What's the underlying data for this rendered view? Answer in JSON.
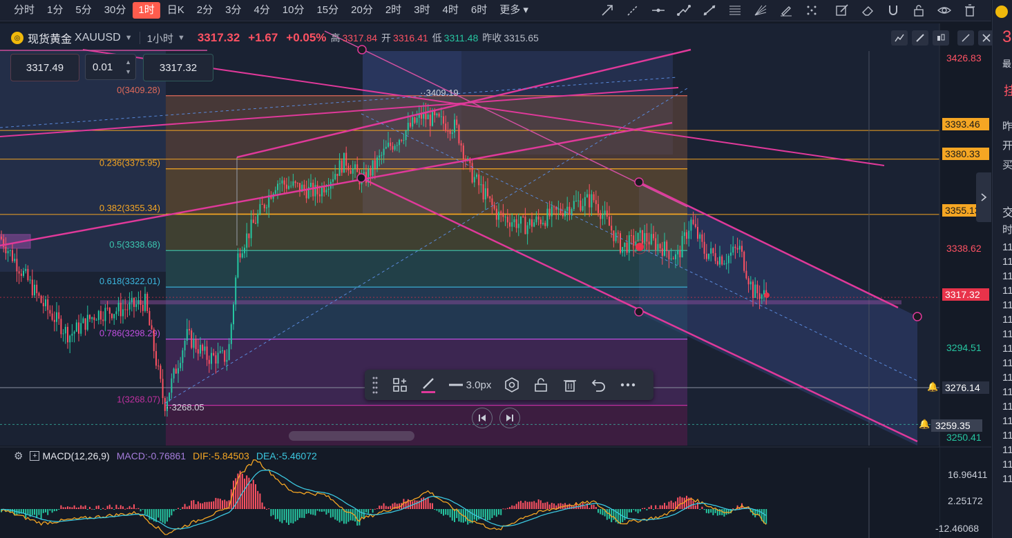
{
  "timeframes": [
    "分时",
    "1分",
    "5分",
    "30分",
    "1时",
    "日K",
    "2分",
    "3分",
    "4分",
    "10分",
    "15分",
    "20分",
    "2时",
    "3时",
    "4时",
    "6时",
    "更多"
  ],
  "active_timeframe": "1时",
  "symbol": {
    "name": "现货黄金",
    "code": "XAUUSD",
    "period": "1小时",
    "price": "3317.32",
    "change": "+1.67",
    "change_pct": "+0.05%",
    "high_label": "高",
    "high": "3317.84",
    "open_label": "开",
    "open": "3316.41",
    "low_label": "低",
    "low": "3311.48",
    "prev_label": "昨收",
    "prev": "3315.65"
  },
  "order": {
    "bid": "3317.49",
    "lot": "0.01",
    "ask": "3317.32"
  },
  "fib": {
    "l0": "0(3409.28)",
    "l236": "0.236(3375.95)",
    "l382": "0.382(3355.34)",
    "l5": "0.5(3338.68)",
    "l618": "0.618(3322.01)",
    "l786": "0.786(3298.29)",
    "l1": "1(3268.07)"
  },
  "annotations": {
    "peak": "3409.19",
    "trough": "3268.05"
  },
  "yaxis": {
    "top": "3426.83",
    "p3393": "3393.46",
    "p3380": "3380.33",
    "p3355": "3355.13",
    "p3338": "3338.62",
    "current": "3317.32",
    "p3294": "3294.51",
    "p3276": "3276.14",
    "p3259": "3259.35",
    "p3250": "3250.41"
  },
  "float_toolbar": {
    "width_label": "3.0px"
  },
  "macd": {
    "title": "MACD(12,26,9)",
    "macd": "MACD:-0.76861",
    "dif": "DIF:-5.84503",
    "dea": "DEA:-5.46072",
    "y1": "16.96411",
    "y2": "2.25172",
    "y3": "-12.46068"
  },
  "colors": {
    "up": "#26c6a1",
    "down": "#ff5263",
    "fib_line": "#f5a623",
    "channel": "#e0399a"
  },
  "side": {
    "t1": "3",
    "t2": "最",
    "t3": "挂",
    "t4": "昨",
    "t5": "开",
    "t6": "买",
    "t7": "交",
    "t8": "时",
    "t9": "11"
  }
}
